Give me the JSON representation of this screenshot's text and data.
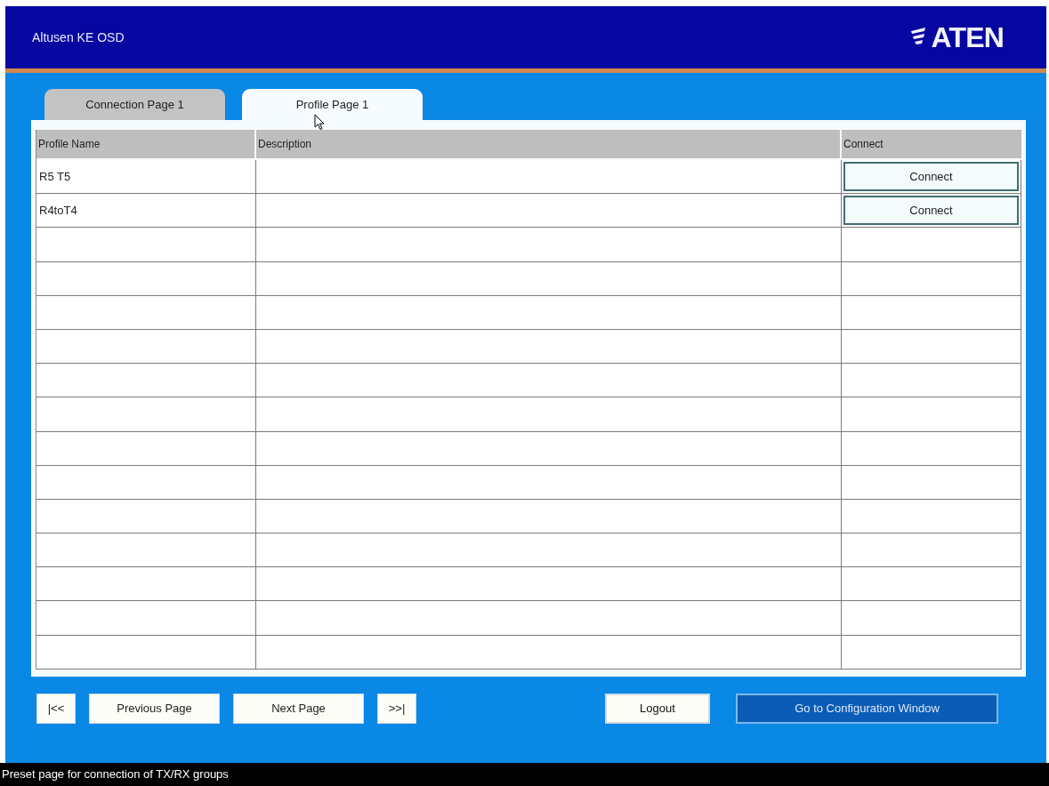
{
  "window": {
    "title": "Altusen KE OSD",
    "logo": "ATEN"
  },
  "tabs": [
    {
      "label": "Connection Page 1",
      "selected": false
    },
    {
      "label": "Profile Page 1",
      "selected": true
    }
  ],
  "table": {
    "columns": [
      "Profile Name",
      "Description",
      "Connect"
    ],
    "rows": [
      {
        "profile_name": "R5 T5",
        "connect": "Connect"
      },
      {
        "profile_name": "R4toT4",
        "connect": "Connect"
      }
    ]
  },
  "nav_buttons": [
    {
      "label": "|<<"
    },
    {
      "label": "Previous Page"
    },
    {
      "label": "Next Page"
    },
    {
      "label": ">>|"
    }
  ],
  "action_buttons": [
    {
      "label": "Logout",
      "kind": "plain"
    },
    {
      "label": "Go to Configuration Window",
      "kind": "highlighted"
    }
  ],
  "status_bar": "Preset page for connection of TX/RX groups"
}
